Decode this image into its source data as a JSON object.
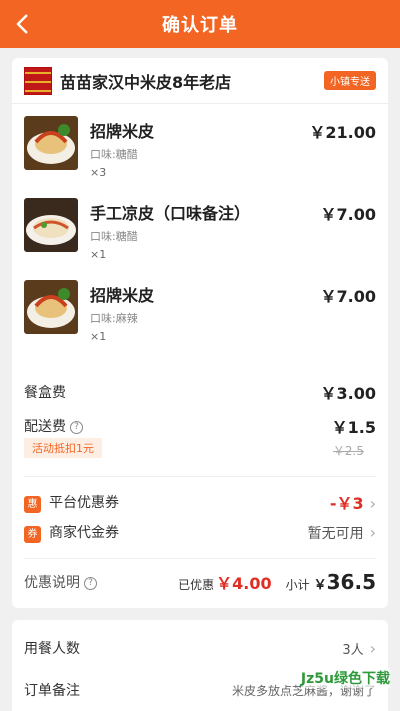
{
  "header": {
    "title": "确认订单"
  },
  "store": {
    "name": "苗苗家汉中米皮8年老店",
    "tag": "小镇专送"
  },
  "items": [
    {
      "name": "招牌米皮",
      "flavor": "口味:糖醋",
      "qty": "×3",
      "price": "￥21.00"
    },
    {
      "name": "手工凉皮（口味备注）",
      "flavor": "口味:糖醋",
      "qty": "×1",
      "price": "￥7.00"
    },
    {
      "name": "招牌米皮",
      "flavor": "口味:麻辣",
      "qty": "×1",
      "price": "￥7.00"
    }
  ],
  "fees": {
    "box_label": "餐盒费",
    "box_value": "￥3.00",
    "delivery_label": "配送费",
    "delivery_value": "￥1.5",
    "promo": "活动抵扣1元",
    "old_price": "￥2.5"
  },
  "coupons": {
    "platform_badge": "惠",
    "platform_label": "平台优惠券",
    "platform_value": "-￥3",
    "merchant_badge": "券",
    "merchant_label": "商家代金券",
    "merchant_value": "暂无可用"
  },
  "summary": {
    "discount_label": "优惠说明",
    "saved_label": "已优惠",
    "saved_value": "￥4.00",
    "subtotal_label": "小计",
    "subtotal_currency": "￥",
    "subtotal_value": "36.5"
  },
  "extra": {
    "diners_label": "用餐人数",
    "diners_value": "3人",
    "note_label": "订单备注",
    "note_value": "米皮多放点芝麻酱，谢谢了"
  },
  "watermark": "Jz5u绿色下载",
  "colors": {
    "accent": "#f26522",
    "price_red": "#e02e24"
  }
}
